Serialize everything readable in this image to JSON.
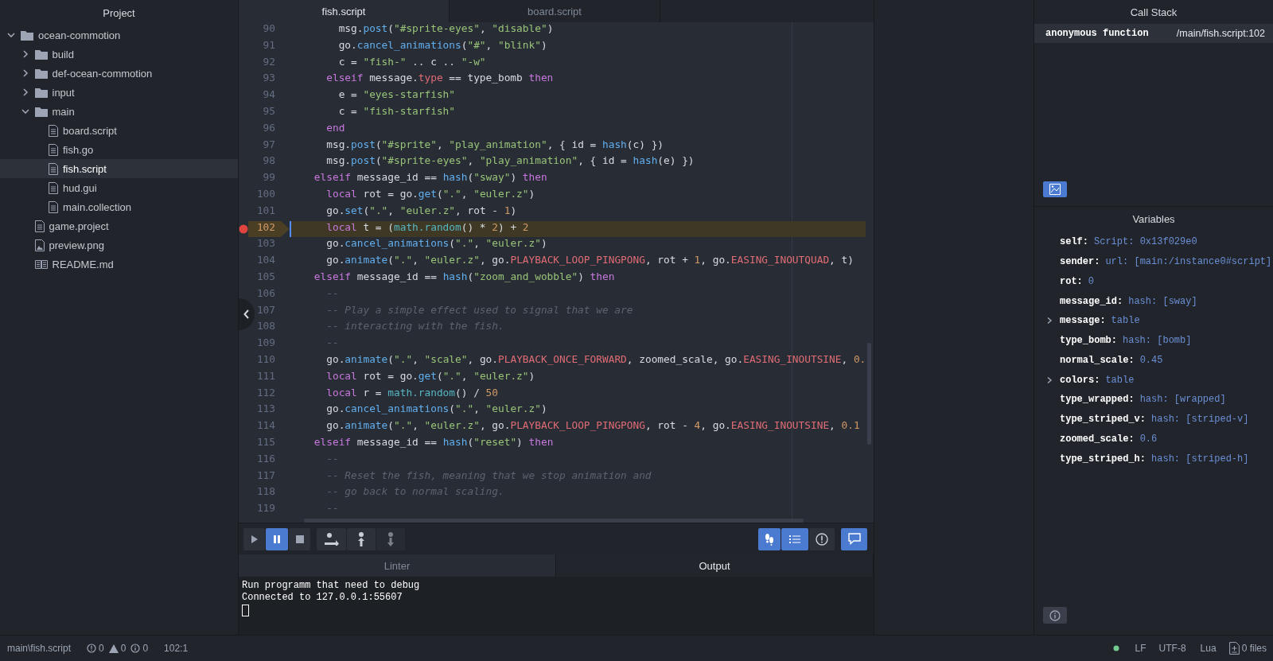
{
  "sidebar": {
    "title": "Project",
    "tree": [
      {
        "kind": "folder",
        "label": "ocean-commotion",
        "expanded": true,
        "selected": false,
        "children": [
          {
            "kind": "folder",
            "label": "build",
            "expanded": false,
            "selected": false
          },
          {
            "kind": "folder",
            "label": "def-ocean-commotion",
            "expanded": false,
            "selected": false
          },
          {
            "kind": "folder",
            "label": "input",
            "expanded": false,
            "selected": false
          },
          {
            "kind": "folder",
            "label": "main",
            "expanded": true,
            "selected": false,
            "children": [
              {
                "kind": "file",
                "label": "board.script",
                "selected": false
              },
              {
                "kind": "file",
                "label": "fish.go",
                "selected": false
              },
              {
                "kind": "file",
                "label": "fish.script",
                "selected": true
              },
              {
                "kind": "file",
                "label": "hud.gui",
                "selected": false
              },
              {
                "kind": "file",
                "label": "main.collection",
                "selected": false
              }
            ]
          },
          {
            "kind": "file",
            "label": "game.project",
            "selected": false
          },
          {
            "kind": "image",
            "label": "preview.png",
            "selected": false
          },
          {
            "kind": "readme",
            "label": "README.md",
            "selected": false
          }
        ]
      }
    ]
  },
  "editor": {
    "tabs": [
      {
        "label": "fish.script",
        "selected": true
      },
      {
        "label": "board.script",
        "selected": false
      }
    ],
    "lines": [
      {
        "number": "90",
        "breakpoint": false,
        "current": false,
        "tokens": [
          {
            "kind": "plain",
            "text": "        msg."
          },
          {
            "kind": "function",
            "text": "post"
          },
          {
            "kind": "plain",
            "text": "("
          },
          {
            "kind": "string",
            "text": "\"#sprite-eyes\""
          },
          {
            "kind": "plain",
            "text": ", "
          },
          {
            "kind": "string",
            "text": "\"disable\""
          },
          {
            "kind": "plain",
            "text": ")"
          }
        ]
      },
      {
        "number": "91",
        "breakpoint": false,
        "current": false,
        "tokens": [
          {
            "kind": "plain",
            "text": "        go."
          },
          {
            "kind": "function",
            "text": "cancel_animations"
          },
          {
            "kind": "plain",
            "text": "("
          },
          {
            "kind": "string",
            "text": "\"#\""
          },
          {
            "kind": "plain",
            "text": ", "
          },
          {
            "kind": "string",
            "text": "\"blink\""
          },
          {
            "kind": "plain",
            "text": ")"
          }
        ]
      },
      {
        "number": "92",
        "breakpoint": false,
        "current": false,
        "tokens": [
          {
            "kind": "plain",
            "text": "        c = "
          },
          {
            "kind": "string",
            "text": "\"fish-\""
          },
          {
            "kind": "plain",
            "text": " .. c .. "
          },
          {
            "kind": "string",
            "text": "\"-w\""
          }
        ]
      },
      {
        "number": "93",
        "breakpoint": false,
        "current": false,
        "tokens": [
          {
            "kind": "keyword",
            "text": "      elseif"
          },
          {
            "kind": "plain",
            "text": " message."
          },
          {
            "kind": "constant",
            "text": "type"
          },
          {
            "kind": "plain",
            "text": " == type_bomb "
          },
          {
            "kind": "keyword",
            "text": "then"
          }
        ]
      },
      {
        "number": "94",
        "breakpoint": false,
        "current": false,
        "tokens": [
          {
            "kind": "plain",
            "text": "        e = "
          },
          {
            "kind": "string",
            "text": "\"eyes-starfish\""
          }
        ]
      },
      {
        "number": "95",
        "breakpoint": false,
        "current": false,
        "tokens": [
          {
            "kind": "plain",
            "text": "        c = "
          },
          {
            "kind": "string",
            "text": "\"fish-starfish\""
          }
        ]
      },
      {
        "number": "96",
        "breakpoint": false,
        "current": false,
        "tokens": [
          {
            "kind": "keyword",
            "text": "      end"
          }
        ]
      },
      {
        "number": "97",
        "breakpoint": false,
        "current": false,
        "tokens": [
          {
            "kind": "plain",
            "text": "      msg."
          },
          {
            "kind": "function",
            "text": "post"
          },
          {
            "kind": "plain",
            "text": "("
          },
          {
            "kind": "string",
            "text": "\"#sprite\""
          },
          {
            "kind": "plain",
            "text": ", "
          },
          {
            "kind": "string",
            "text": "\"play_animation\""
          },
          {
            "kind": "plain",
            "text": ", { id = "
          },
          {
            "kind": "function",
            "text": "hash"
          },
          {
            "kind": "plain",
            "text": "(c) })"
          }
        ]
      },
      {
        "number": "98",
        "breakpoint": false,
        "current": false,
        "tokens": [
          {
            "kind": "plain",
            "text": "      msg."
          },
          {
            "kind": "function",
            "text": "post"
          },
          {
            "kind": "plain",
            "text": "("
          },
          {
            "kind": "string",
            "text": "\"#sprite-eyes\""
          },
          {
            "kind": "plain",
            "text": ", "
          },
          {
            "kind": "string",
            "text": "\"play_animation\""
          },
          {
            "kind": "plain",
            "text": ", { id = "
          },
          {
            "kind": "function",
            "text": "hash"
          },
          {
            "kind": "plain",
            "text": "(e) })"
          }
        ]
      },
      {
        "number": "99",
        "breakpoint": false,
        "current": false,
        "tokens": [
          {
            "kind": "keyword",
            "text": "    elseif"
          },
          {
            "kind": "plain",
            "text": " message_id == "
          },
          {
            "kind": "function",
            "text": "hash"
          },
          {
            "kind": "plain",
            "text": "("
          },
          {
            "kind": "string",
            "text": "\"sway\""
          },
          {
            "kind": "plain",
            "text": ") "
          },
          {
            "kind": "keyword",
            "text": "then"
          }
        ]
      },
      {
        "number": "100",
        "breakpoint": false,
        "current": false,
        "tokens": [
          {
            "kind": "keyword",
            "text": "      local"
          },
          {
            "kind": "plain",
            "text": " rot = go."
          },
          {
            "kind": "function",
            "text": "get"
          },
          {
            "kind": "plain",
            "text": "("
          },
          {
            "kind": "string",
            "text": "\".\""
          },
          {
            "kind": "plain",
            "text": ", "
          },
          {
            "kind": "string",
            "text": "\"euler.z\""
          },
          {
            "kind": "plain",
            "text": ")"
          }
        ]
      },
      {
        "number": "101",
        "breakpoint": false,
        "current": false,
        "tokens": [
          {
            "kind": "plain",
            "text": "      go."
          },
          {
            "kind": "function",
            "text": "set"
          },
          {
            "kind": "plain",
            "text": "("
          },
          {
            "kind": "string",
            "text": "\".\""
          },
          {
            "kind": "plain",
            "text": ", "
          },
          {
            "kind": "string",
            "text": "\"euler.z\""
          },
          {
            "kind": "plain",
            "text": ", rot - "
          },
          {
            "kind": "number",
            "text": "1"
          },
          {
            "kind": "plain",
            "text": ")"
          }
        ]
      },
      {
        "number": "102",
        "breakpoint": true,
        "current": true,
        "tokens": [
          {
            "kind": "keyword",
            "text": "      local"
          },
          {
            "kind": "plain",
            "text": " t = ("
          },
          {
            "kind": "builtin",
            "text": "math.random"
          },
          {
            "kind": "plain",
            "text": "() * "
          },
          {
            "kind": "number",
            "text": "2"
          },
          {
            "kind": "plain",
            "text": ") + "
          },
          {
            "kind": "number",
            "text": "2"
          }
        ]
      },
      {
        "number": "103",
        "breakpoint": false,
        "current": false,
        "tokens": [
          {
            "kind": "plain",
            "text": "      go."
          },
          {
            "kind": "function",
            "text": "cancel_animations"
          },
          {
            "kind": "plain",
            "text": "("
          },
          {
            "kind": "string",
            "text": "\".\""
          },
          {
            "kind": "plain",
            "text": ", "
          },
          {
            "kind": "string",
            "text": "\"euler.z\""
          },
          {
            "kind": "plain",
            "text": ")"
          }
        ]
      },
      {
        "number": "104",
        "breakpoint": false,
        "current": false,
        "tokens": [
          {
            "kind": "plain",
            "text": "      go."
          },
          {
            "kind": "function",
            "text": "animate"
          },
          {
            "kind": "plain",
            "text": "("
          },
          {
            "kind": "string",
            "text": "\".\""
          },
          {
            "kind": "plain",
            "text": ", "
          },
          {
            "kind": "string",
            "text": "\"euler.z\""
          },
          {
            "kind": "plain",
            "text": ", go."
          },
          {
            "kind": "constant",
            "text": "PLAYBACK_LOOP_PINGPONG"
          },
          {
            "kind": "plain",
            "text": ", rot + "
          },
          {
            "kind": "number",
            "text": "1"
          },
          {
            "kind": "plain",
            "text": ", go."
          },
          {
            "kind": "constant",
            "text": "EASING_INOUTQUAD"
          },
          {
            "kind": "plain",
            "text": ", t)"
          }
        ]
      },
      {
        "number": "105",
        "breakpoint": false,
        "current": false,
        "tokens": [
          {
            "kind": "keyword",
            "text": "    elseif"
          },
          {
            "kind": "plain",
            "text": " message_id == "
          },
          {
            "kind": "function",
            "text": "hash"
          },
          {
            "kind": "plain",
            "text": "("
          },
          {
            "kind": "string",
            "text": "\"zoom_and_wobble\""
          },
          {
            "kind": "plain",
            "text": ") "
          },
          {
            "kind": "keyword",
            "text": "then"
          }
        ]
      },
      {
        "number": "106",
        "breakpoint": false,
        "current": false,
        "tokens": [
          {
            "kind": "comment",
            "text": "      --"
          }
        ]
      },
      {
        "number": "107",
        "breakpoint": false,
        "current": false,
        "tokens": [
          {
            "kind": "comment",
            "text": "      -- Play a simple effect used to signal that we are"
          }
        ]
      },
      {
        "number": "108",
        "breakpoint": false,
        "current": false,
        "tokens": [
          {
            "kind": "comment",
            "text": "      -- interacting with the fish."
          }
        ]
      },
      {
        "number": "109",
        "breakpoint": false,
        "current": false,
        "tokens": [
          {
            "kind": "comment",
            "text": "      --"
          }
        ]
      },
      {
        "number": "110",
        "breakpoint": false,
        "current": false,
        "tokens": [
          {
            "kind": "plain",
            "text": "      go."
          },
          {
            "kind": "function",
            "text": "animate"
          },
          {
            "kind": "plain",
            "text": "("
          },
          {
            "kind": "string",
            "text": "\".\""
          },
          {
            "kind": "plain",
            "text": ", "
          },
          {
            "kind": "string",
            "text": "\"scale\""
          },
          {
            "kind": "plain",
            "text": ", go."
          },
          {
            "kind": "constant",
            "text": "PLAYBACK_ONCE_FORWARD"
          },
          {
            "kind": "plain",
            "text": ", zoomed_scale, go."
          },
          {
            "kind": "constant",
            "text": "EASING_INOUTSINE"
          },
          {
            "kind": "plain",
            "text": ", "
          },
          {
            "kind": "number",
            "text": "0."
          }
        ]
      },
      {
        "number": "111",
        "breakpoint": false,
        "current": false,
        "tokens": [
          {
            "kind": "keyword",
            "text": "      local"
          },
          {
            "kind": "plain",
            "text": " rot = go."
          },
          {
            "kind": "function",
            "text": "get"
          },
          {
            "kind": "plain",
            "text": "("
          },
          {
            "kind": "string",
            "text": "\".\""
          },
          {
            "kind": "plain",
            "text": ", "
          },
          {
            "kind": "string",
            "text": "\"euler.z\""
          },
          {
            "kind": "plain",
            "text": ")"
          }
        ]
      },
      {
        "number": "112",
        "breakpoint": false,
        "current": false,
        "tokens": [
          {
            "kind": "keyword",
            "text": "      local"
          },
          {
            "kind": "plain",
            "text": " r = "
          },
          {
            "kind": "builtin",
            "text": "math.random"
          },
          {
            "kind": "plain",
            "text": "() / "
          },
          {
            "kind": "number",
            "text": "50"
          }
        ]
      },
      {
        "number": "113",
        "breakpoint": false,
        "current": false,
        "tokens": [
          {
            "kind": "plain",
            "text": "      go."
          },
          {
            "kind": "function",
            "text": "cancel_animations"
          },
          {
            "kind": "plain",
            "text": "("
          },
          {
            "kind": "string",
            "text": "\".\""
          },
          {
            "kind": "plain",
            "text": ", "
          },
          {
            "kind": "string",
            "text": "\"euler.z\""
          },
          {
            "kind": "plain",
            "text": ")"
          }
        ]
      },
      {
        "number": "114",
        "breakpoint": false,
        "current": false,
        "tokens": [
          {
            "kind": "plain",
            "text": "      go."
          },
          {
            "kind": "function",
            "text": "animate"
          },
          {
            "kind": "plain",
            "text": "("
          },
          {
            "kind": "string",
            "text": "\".\""
          },
          {
            "kind": "plain",
            "text": ", "
          },
          {
            "kind": "string",
            "text": "\"euler.z\""
          },
          {
            "kind": "plain",
            "text": ", go."
          },
          {
            "kind": "constant",
            "text": "PLAYBACK_LOOP_PINGPONG"
          },
          {
            "kind": "plain",
            "text": ", rot - "
          },
          {
            "kind": "number",
            "text": "4"
          },
          {
            "kind": "plain",
            "text": ", go."
          },
          {
            "kind": "constant",
            "text": "EASING_INOUTSINE"
          },
          {
            "kind": "plain",
            "text": ", "
          },
          {
            "kind": "number",
            "text": "0.1"
          }
        ]
      },
      {
        "number": "115",
        "breakpoint": false,
        "current": false,
        "tokens": [
          {
            "kind": "keyword",
            "text": "    elseif"
          },
          {
            "kind": "plain",
            "text": " message_id == "
          },
          {
            "kind": "function",
            "text": "hash"
          },
          {
            "kind": "plain",
            "text": "("
          },
          {
            "kind": "string",
            "text": "\"reset\""
          },
          {
            "kind": "plain",
            "text": ") "
          },
          {
            "kind": "keyword",
            "text": "then"
          }
        ]
      },
      {
        "number": "116",
        "breakpoint": false,
        "current": false,
        "tokens": [
          {
            "kind": "comment",
            "text": "      --"
          }
        ]
      },
      {
        "number": "117",
        "breakpoint": false,
        "current": false,
        "tokens": [
          {
            "kind": "comment",
            "text": "      -- Reset the fish, meaning that we stop animation and"
          }
        ]
      },
      {
        "number": "118",
        "breakpoint": false,
        "current": false,
        "tokens": [
          {
            "kind": "comment",
            "text": "      -- go back to normal scaling."
          }
        ]
      },
      {
        "number": "119",
        "breakpoint": false,
        "current": false,
        "tokens": [
          {
            "kind": "comment",
            "text": "      --"
          }
        ]
      }
    ]
  },
  "debug_toolbar": {
    "buttons": [
      {
        "kind": "play",
        "on": false,
        "disabled": false
      },
      {
        "kind": "pause",
        "on": true,
        "disabled": false
      },
      {
        "kind": "stop",
        "on": false,
        "disabled": false
      },
      {
        "kind": "step_over",
        "on": false,
        "disabled": false
      },
      {
        "kind": "step_out",
        "on": false,
        "disabled": false
      },
      {
        "kind": "step_into",
        "on": false,
        "disabled": true
      }
    ],
    "view_buttons": [
      {
        "kind": "breakpoints",
        "on": true
      },
      {
        "kind": "list",
        "on": true
      },
      {
        "kind": "alerts",
        "on": false
      },
      {
        "kind": "console",
        "on": true
      }
    ]
  },
  "bottom_panel": {
    "tabs": [
      {
        "label": "Linter",
        "selected": false
      },
      {
        "label": "Output",
        "selected": true
      }
    ],
    "output_lines": [
      "Run programm that need to debug",
      "Connected to 127.0.0.1:55607"
    ]
  },
  "call_stack": {
    "title": "Call Stack",
    "frames": [
      {
        "function": "anonymous function",
        "location": "/main/fish.script:102",
        "selected": true
      }
    ]
  },
  "variables": {
    "title": "Variables",
    "items": [
      {
        "name": "self:",
        "value": "Script: 0x13f029e0",
        "expandable": false
      },
      {
        "name": "sender:",
        "value": "url: [main:/instance0#script]",
        "expandable": false
      },
      {
        "name": "rot:",
        "value": "0",
        "expandable": false
      },
      {
        "name": "message_id:",
        "value": "hash: [sway]",
        "expandable": false
      },
      {
        "name": "message:",
        "value": "table",
        "expandable": true
      },
      {
        "name": "type_bomb:",
        "value": "hash: [bomb]",
        "expandable": false
      },
      {
        "name": "normal_scale:",
        "value": "0.45",
        "expandable": false
      },
      {
        "name": "colors:",
        "value": "table",
        "expandable": true
      },
      {
        "name": "type_wrapped:",
        "value": "hash: [wrapped]",
        "expandable": false
      },
      {
        "name": "type_striped_v:",
        "value": "hash: [striped-v]",
        "expandable": false
      },
      {
        "name": "zoomed_scale:",
        "value": "0.6",
        "expandable": false
      },
      {
        "name": "type_striped_h:",
        "value": "hash: [striped-h]",
        "expandable": false
      }
    ]
  },
  "status_bar": {
    "file_path": "main\\fish.script",
    "errors": "0",
    "warnings": "0",
    "infos": "0",
    "cursor": "102:1",
    "line_ending": "LF",
    "encoding": "UTF-8",
    "language": "Lua",
    "files": "0 files"
  }
}
